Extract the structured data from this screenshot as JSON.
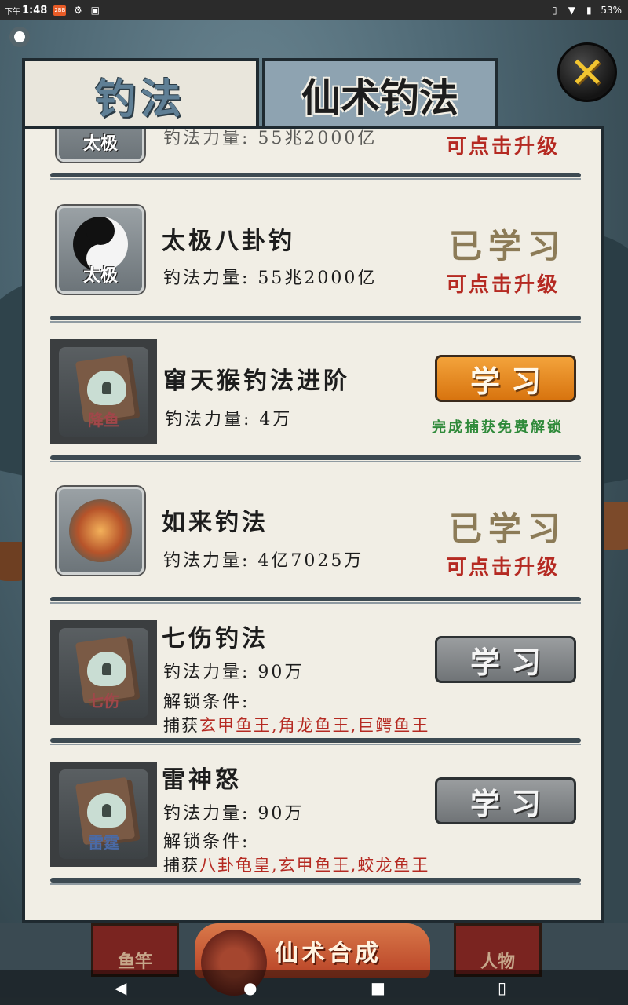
{
  "status_bar": {
    "ampm": "下午",
    "time": "1:48",
    "app_badge": "2BB",
    "battery": "53%"
  },
  "tabs": [
    {
      "label": "钓法",
      "active": false
    },
    {
      "label": "仙术钓法",
      "active": true
    }
  ],
  "close_label": "✕",
  "rows": [
    {
      "title": "",
      "power": "钓法力量: 55兆2000亿",
      "icon_label": "太极",
      "status": "可点击升级"
    },
    {
      "title": "太极八卦钓",
      "power": "钓法力量: 55兆2000亿",
      "icon_label": "太极",
      "status_top": "已学习",
      "status": "可点击升级"
    },
    {
      "title": "窜天猴钓法进阶",
      "power": "钓法力量: 4万",
      "icon_label": "降鱼",
      "button": "学习",
      "button_style": "orange",
      "note": "完成捕获免费解锁"
    },
    {
      "title": "如来钓法",
      "power": "钓法力量: 4亿7025万",
      "status_top": "已学习",
      "status": "可点击升级"
    },
    {
      "title": "七伤钓法",
      "power": "钓法力量: 90万",
      "icon_label": "七伤",
      "unlock_label": "解锁条件:",
      "unlock_prefix": "捕获",
      "unlock_targets": "玄甲鱼王,角龙鱼王,巨鳄鱼王",
      "button": "学习",
      "button_style": "gray"
    },
    {
      "title": "雷神怒",
      "power": "钓法力量: 90万",
      "icon_label": "雷霆",
      "unlock_label": "解锁条件:",
      "unlock_prefix": "捕获",
      "unlock_targets": "八卦龟皇,玄甲鱼王,蛟龙鱼王",
      "button": "学习",
      "button_style": "gray"
    }
  ],
  "bottom_bar": {
    "tile_left": "鱼竿",
    "synth_label": "仙术合成",
    "tile_right": "人物"
  },
  "nav": {
    "back": "◀",
    "home": "●",
    "recent": "■",
    "extra": "▯"
  }
}
